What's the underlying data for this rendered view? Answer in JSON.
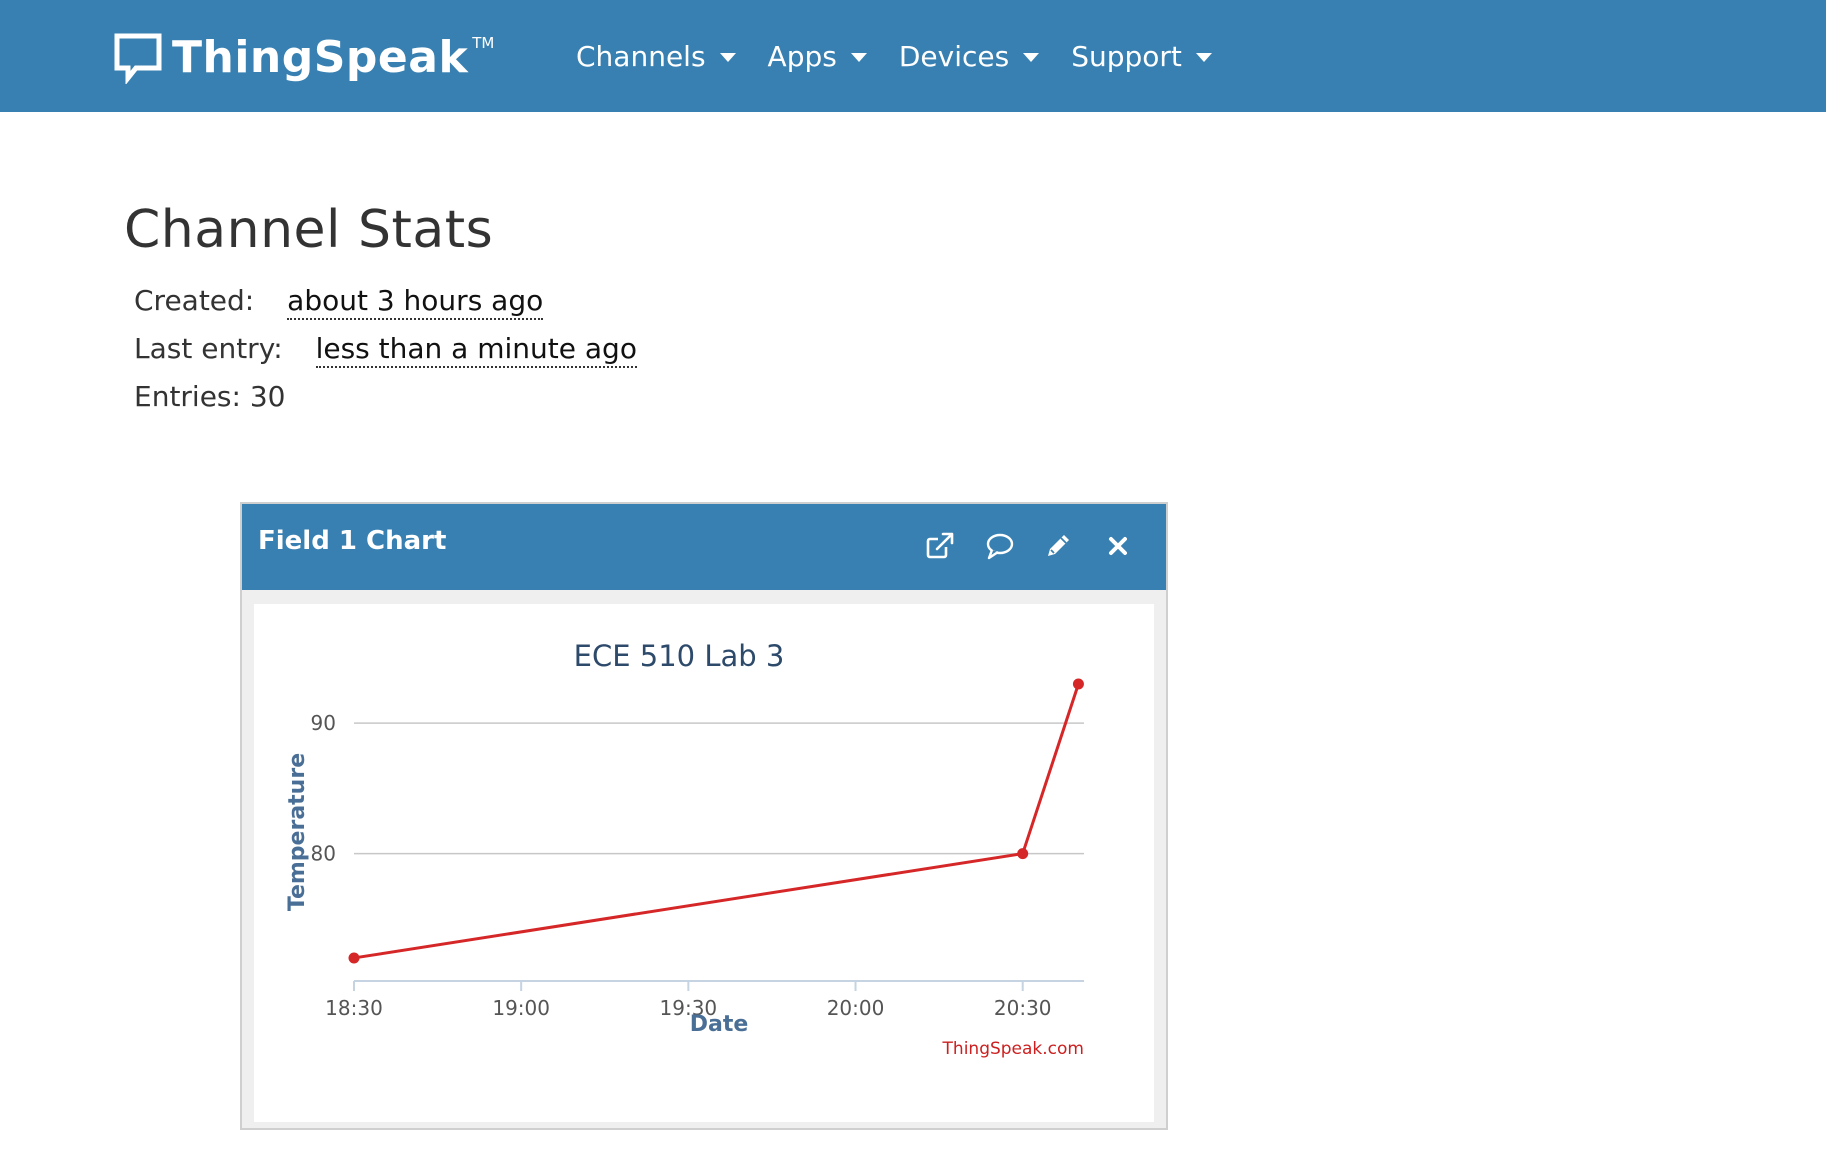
{
  "brand": {
    "name": "ThingSpeak",
    "tm": "TM"
  },
  "nav": {
    "items": [
      {
        "label": "Channels"
      },
      {
        "label": "Apps"
      },
      {
        "label": "Devices"
      },
      {
        "label": "Support"
      }
    ]
  },
  "stats": {
    "title": "Channel Stats",
    "created_label": "Created:",
    "created_value": "about 3 hours ago",
    "last_entry_label": "Last entry:",
    "last_entry_value": "less than a minute ago",
    "entries_text": "Entries: 30"
  },
  "widget": {
    "title": "Field 1 Chart",
    "icons": [
      "external-link-icon",
      "comment-icon",
      "pencil-icon",
      "close-icon"
    ]
  },
  "colors": {
    "navbar": "#3780b1",
    "series": "#d62728",
    "axis_title": "#4a6f96",
    "chart_title": "#2d4a6b",
    "credit": "#cc1f1f"
  },
  "chart_data": {
    "type": "line",
    "title": "ECE 510 Lab 3",
    "xlabel": "Date",
    "ylabel": "Temperature",
    "x_ticks": [
      "18:30",
      "19:00",
      "19:30",
      "20:00",
      "20:30"
    ],
    "y_ticks": [
      80,
      90
    ],
    "xlim": [
      "18:30",
      "20:41"
    ],
    "ylim": [
      71,
      93
    ],
    "grid": true,
    "credit": "ThingSpeak.com",
    "series": [
      {
        "x": [
          "18:30",
          "20:30",
          "20:40"
        ],
        "y": [
          72,
          80,
          93
        ]
      }
    ]
  }
}
